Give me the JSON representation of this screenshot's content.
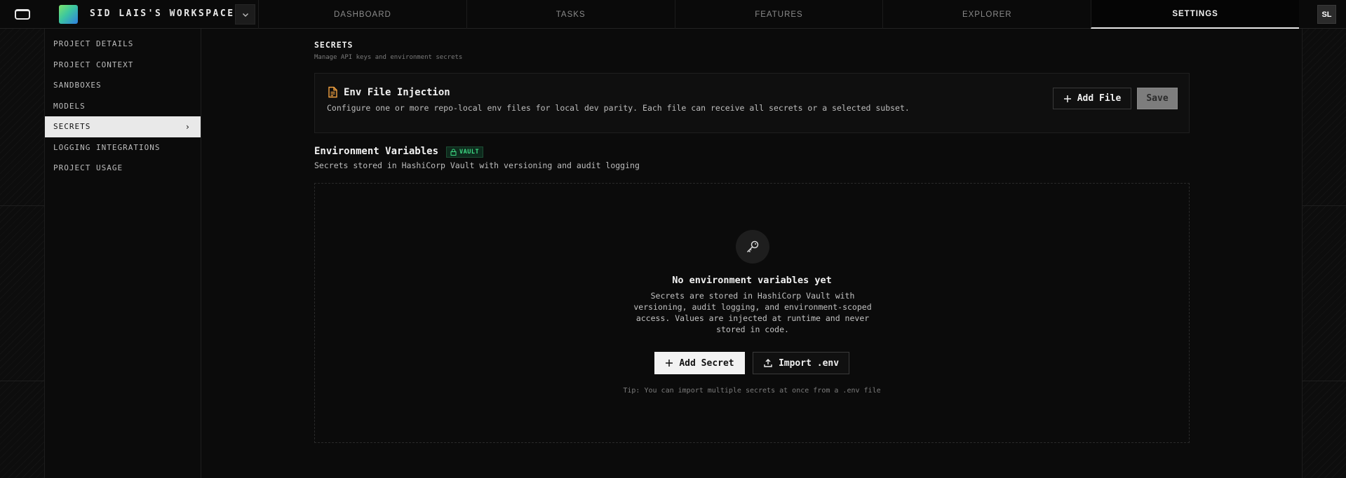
{
  "workspace": {
    "name": "SID LAIS'S WORKSPACE"
  },
  "nav": {
    "tabs": [
      {
        "label": "DASHBOARD"
      },
      {
        "label": "TASKS"
      },
      {
        "label": "FEATURES"
      },
      {
        "label": "EXPLORER"
      },
      {
        "label": "SETTINGS",
        "active": true
      }
    ]
  },
  "user": {
    "initials": "SL"
  },
  "sidebar": {
    "items": [
      {
        "label": "PROJECT DETAILS"
      },
      {
        "label": "PROJECT CONTEXT"
      },
      {
        "label": "SANDBOXES"
      },
      {
        "label": "MODELS"
      },
      {
        "label": "SECRETS",
        "active": true
      },
      {
        "label": "LOGGING INTEGRATIONS"
      },
      {
        "label": "PROJECT USAGE"
      }
    ]
  },
  "section": {
    "title": "SECRETS",
    "subtitle": "Manage API keys and environment secrets"
  },
  "env_injection": {
    "title": "Env File Injection",
    "description": "Configure one or more repo-local env files for local dev parity. Each file can receive all secrets or a selected subset.",
    "add_file_label": "Add File",
    "save_label": "Save"
  },
  "env_vars": {
    "title": "Environment Variables",
    "badge": "VAULT",
    "subtitle": "Secrets stored in HashiCorp Vault with versioning and audit logging",
    "empty_title": "No environment variables yet",
    "empty_desc": "Secrets are stored in HashiCorp Vault with versioning, audit logging, and environment-scoped access. Values are injected at runtime and never stored in code.",
    "add_secret_label": "Add Secret",
    "import_label": "Import .env",
    "tip": "Tip: You can import multiple secrets at once from a .env file"
  },
  "colors": {
    "accent_badge": "#3ddc84",
    "env_icon": "#f0a040",
    "background": "#0b0b0b"
  },
  "icons": {
    "logo": "app-logo-icon",
    "env_file": "file-text-icon",
    "vault": "lock-icon",
    "empty": "key-icon",
    "add": "plus-icon",
    "import": "upload-icon",
    "dropdown": "chevron-down-icon",
    "sidebar_active": "chevron-right-icon"
  }
}
